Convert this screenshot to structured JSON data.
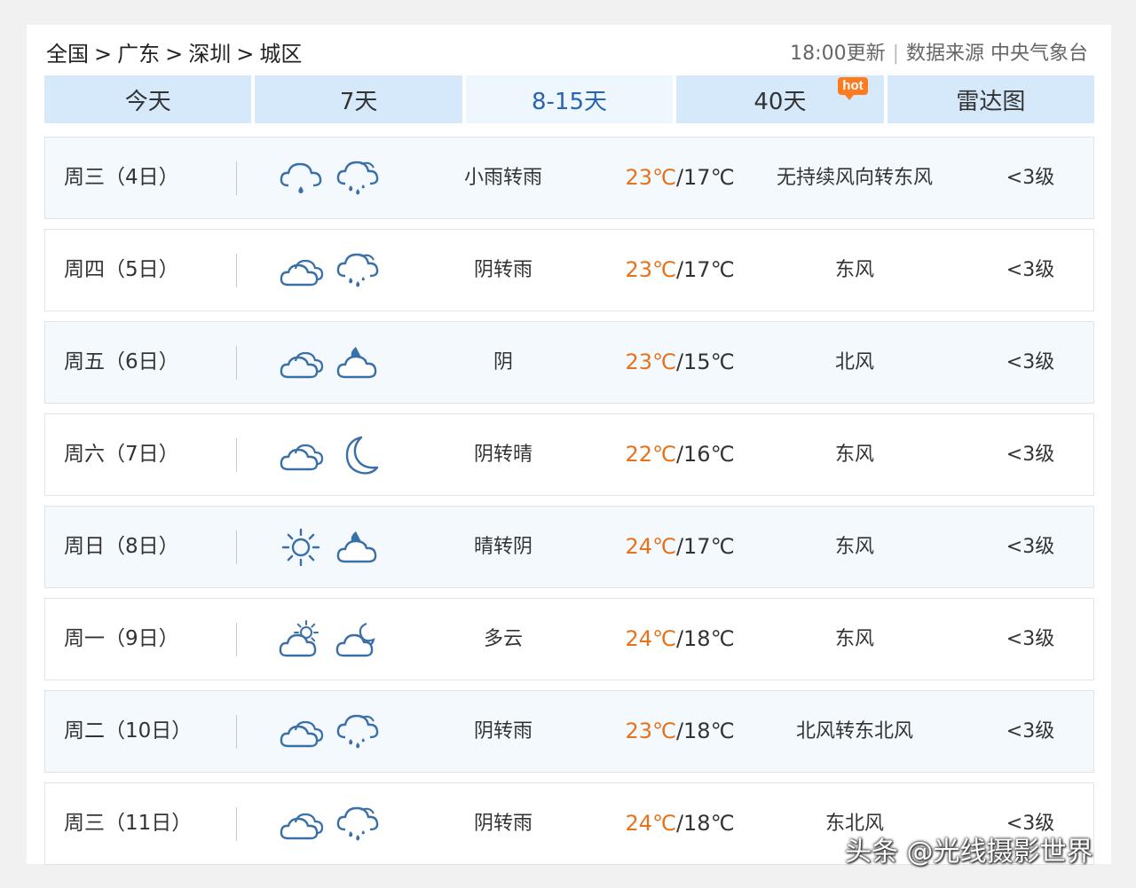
{
  "breadcrumb": [
    "全国",
    "广东",
    "深圳",
    "城区"
  ],
  "breadcrumb_sep": ">",
  "meta": {
    "update": "18:00更新",
    "divider": "|",
    "source": "数据来源 中央气象台"
  },
  "tabs": [
    {
      "label": "今天"
    },
    {
      "label": "7天"
    },
    {
      "label": "8-15天",
      "active": true
    },
    {
      "label": "40天",
      "badge": "hot"
    },
    {
      "label": "雷达图"
    }
  ],
  "colors": {
    "tab_bg": "#d6e9fb",
    "tab_active_text": "#2a62b5",
    "high_temp": "#e8721c",
    "hot_badge": "#ff7b1f",
    "icon_blue": "#3a6fa8"
  },
  "days": [
    {
      "day": "周三（4日）",
      "icon_day": "light-rain",
      "icon_night": "rain",
      "desc": "小雨转雨",
      "high": "23℃",
      "low": "/17℃",
      "wind": "无持续风向转东风",
      "level": "<3级"
    },
    {
      "day": "周四（5日）",
      "icon_day": "overcast",
      "icon_night": "rain",
      "desc": "阴转雨",
      "high": "23℃",
      "low": "/17℃",
      "wind": "东风",
      "level": "<3级"
    },
    {
      "day": "周五（6日）",
      "icon_day": "overcast",
      "icon_night": "cloudy-night",
      "desc": "阴",
      "high": "23℃",
      "low": "/15℃",
      "wind": "北风",
      "level": "<3级"
    },
    {
      "day": "周六（7日）",
      "icon_day": "overcast",
      "icon_night": "clear-night",
      "desc": "阴转晴",
      "high": "22℃",
      "low": "/16℃",
      "wind": "东风",
      "level": "<3级"
    },
    {
      "day": "周日（8日）",
      "icon_day": "sunny",
      "icon_night": "cloudy-night",
      "desc": "晴转阴",
      "high": "24℃",
      "low": "/17℃",
      "wind": "东风",
      "level": "<3级"
    },
    {
      "day": "周一（9日）",
      "icon_day": "partly-cloudy-day",
      "icon_night": "partly-cloudy-night",
      "desc": "多云",
      "high": "24℃",
      "low": "/18℃",
      "wind": "东风",
      "level": "<3级"
    },
    {
      "day": "周二（10日）",
      "icon_day": "overcast",
      "icon_night": "rain",
      "desc": "阴转雨",
      "high": "23℃",
      "low": "/18℃",
      "wind": "北风转东北风",
      "level": "<3级"
    },
    {
      "day": "周三（11日）",
      "icon_day": "overcast",
      "icon_night": "rain",
      "desc": "阴转雨",
      "high": "24℃",
      "low": "/18℃",
      "wind": "东北风",
      "level": "<3级"
    }
  ],
  "watermark": "头条 @光线摄影世界"
}
